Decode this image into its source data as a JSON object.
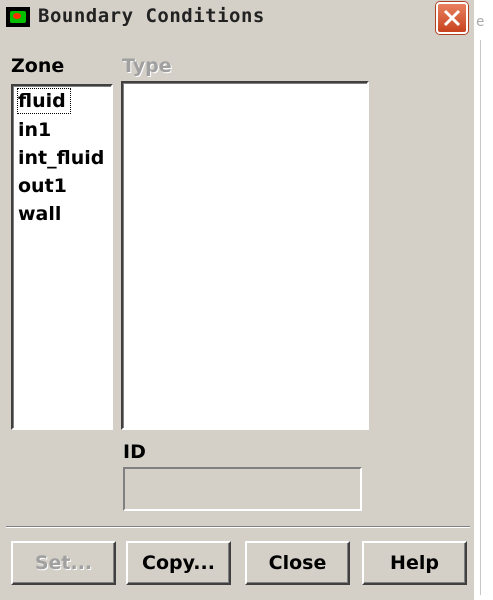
{
  "window": {
    "title": "Boundary Conditions"
  },
  "background": {
    "fragment": "e"
  },
  "zone": {
    "label": "Zone",
    "items": [
      "fluid",
      "in1",
      "int_fluid",
      "out1",
      "wall"
    ],
    "focused_index": 0
  },
  "type": {
    "label": "Type",
    "items": []
  },
  "id": {
    "label": "ID",
    "value": ""
  },
  "buttons": {
    "set": "Set...",
    "copy": "Copy...",
    "close": "Close",
    "help": "Help"
  },
  "colors": {
    "dialog_bg": "#d4d0c8",
    "close_button": "#d8553a",
    "disabled_text": "#a0a0a0"
  }
}
